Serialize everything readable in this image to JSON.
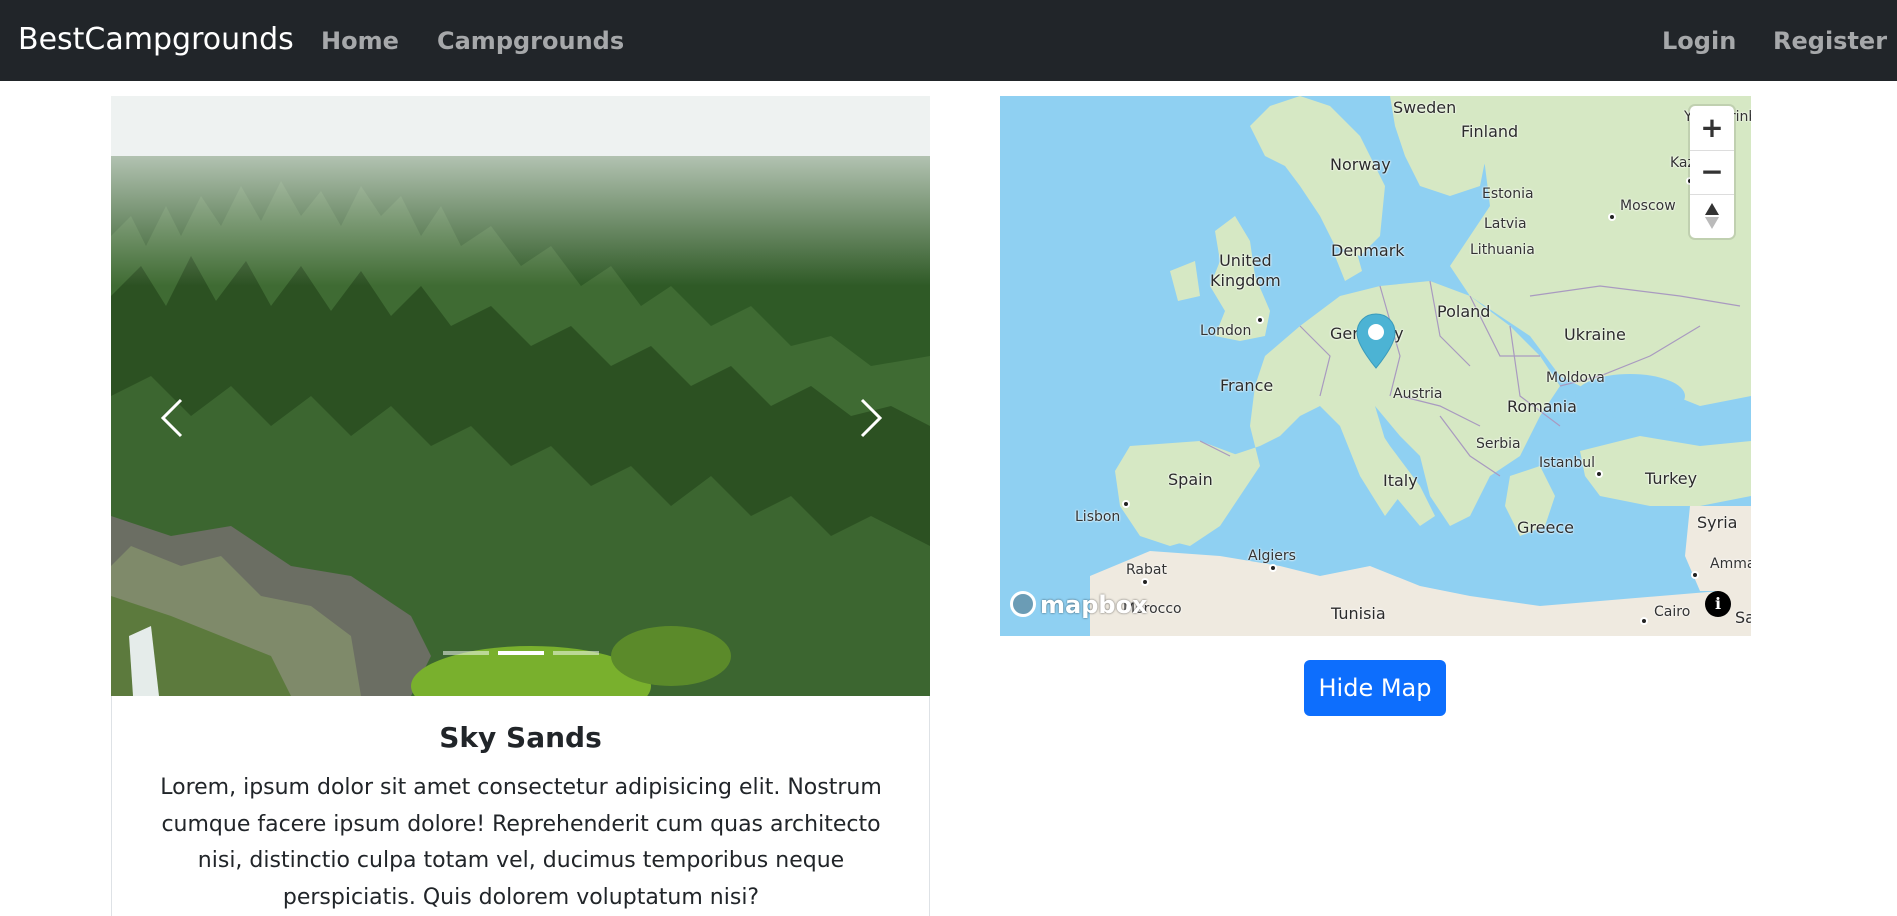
{
  "navbar": {
    "brand": "BestCampgrounds",
    "links": [
      "Home",
      "Campgrounds"
    ],
    "right_links": [
      "Login",
      "Register"
    ],
    "background": "#212529"
  },
  "carousel": {
    "prev_icon": "chevron-left-icon",
    "next_icon": "chevron-right-icon",
    "slide_count": 3,
    "active_index": 1
  },
  "campground": {
    "title": "Sky Sands",
    "description": "Lorem, ipsum dolor sit amet consectetur adipisicing elit. Nostrum cumque facere ipsum dolore! Reprehenderit cum quas architecto nisi, distinctio culpa totam vel, ducimus temporibus neque perspiciatis. Quis dolorem voluptatum nisi?"
  },
  "map": {
    "labels": {
      "sweden": "Sweden",
      "finland": "Finland",
      "norway": "Norway",
      "estonia": "Estonia",
      "moscow": "Moscow",
      "latvia": "Latvia",
      "lithuania": "Lithuania",
      "denmark": "Denmark",
      "united_kingdom": "United\nKingdom",
      "london": "London",
      "germany": "Germany",
      "poland": "Poland",
      "ukraine": "Ukraine",
      "moldova": "Moldova",
      "france": "France",
      "austria": "Austria",
      "romania": "Romania",
      "serbia": "Serbia",
      "spain": "Spain",
      "italy": "Italy",
      "istanbul": "Istanbul",
      "turkey": "Turkey",
      "lisbon": "Lisbon",
      "greece": "Greece",
      "syria": "Syria",
      "rabat": "Rabat",
      "algiers": "Algiers",
      "amman": "Amman",
      "morocco": "Morocco",
      "tunisia": "Tunisia",
      "cairo": "Cairo",
      "kazan_partial": "Kaz",
      "yekaterinburg_partial": "Yekaterinb",
      "sa_partial": "Sa"
    },
    "zoom_in": "+",
    "zoom_out": "−",
    "compass_icon": "compass-icon",
    "marker_icon": "map-pin-icon",
    "attribution": "mapbox",
    "info": "i",
    "water_color": "#8fd0f2",
    "land_color": "#d6e8c4"
  },
  "buttons": {
    "hide_map": "Hide Map",
    "primary_color": "#0d6efd"
  }
}
